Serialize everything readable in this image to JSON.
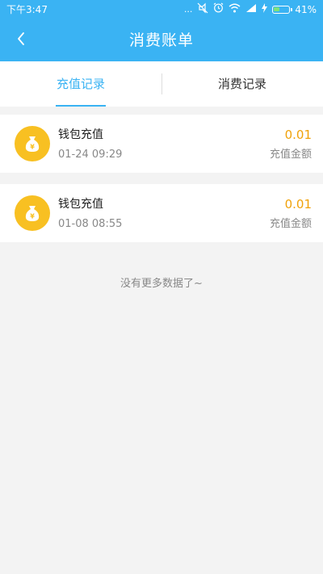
{
  "status_bar": {
    "time": "下午3:47",
    "more": "...",
    "battery_percent": "41%",
    "battery_level": 0.41
  },
  "header": {
    "title": "消费账单",
    "back_icon": "chevron-left-icon"
  },
  "tabs": [
    {
      "label": "充值记录",
      "active": true
    },
    {
      "label": "消费记录",
      "active": false
    }
  ],
  "records": [
    {
      "icon": "money-bag-icon",
      "title": "钱包充值",
      "time": "01-24 09:29",
      "amount": "0.01",
      "type_label": "充值金额"
    },
    {
      "icon": "money-bag-icon",
      "title": "钱包充值",
      "time": "01-08 08:55",
      "amount": "0.01",
      "type_label": "充值金额"
    }
  ],
  "footer": {
    "no_more_text": "没有更多数据了~"
  },
  "colors": {
    "primary": "#3ab3f3",
    "amount": "#f0a20a",
    "icon_bg": "#f8c022",
    "page_bg": "#f3f3f3"
  }
}
